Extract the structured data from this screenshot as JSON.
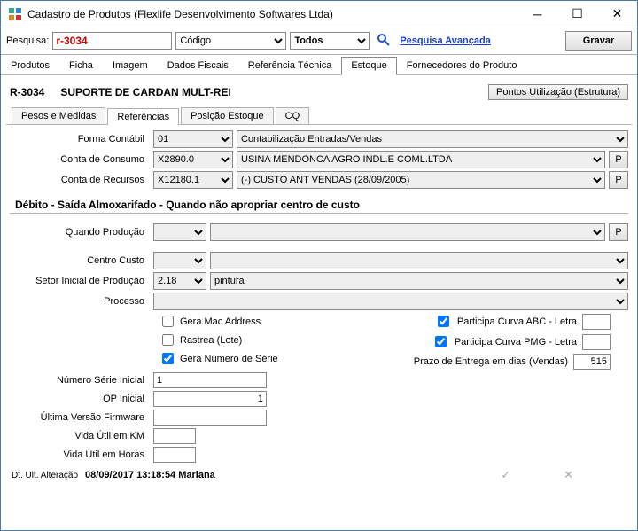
{
  "window": {
    "title": "Cadastro de Produtos (Flexlife Desenvolvimento Softwares Ltda)"
  },
  "searchbar": {
    "label": "Pesquisa:",
    "value": "r-3034",
    "combo_field": "Código",
    "combo_scope": "Todos",
    "adv": "Pesquisa Avançada",
    "gravar": "Gravar"
  },
  "maintabs": {
    "t0": "Produtos",
    "t1": "Ficha",
    "t2": "Imagem",
    "t3": "Dados Fiscais",
    "t4": "Referência Técnica",
    "t5": "Estoque",
    "t6": "Fornecedores do Produto"
  },
  "product": {
    "code": "R-3034",
    "name": "SUPORTE DE CARDAN MULT-REI",
    "pontos": "Pontos Utilização (Estrutura)"
  },
  "subtabs": {
    "s0": "Pesos e Medidas",
    "s1": "Referências",
    "s2": "Posição Estoque",
    "s3": "CQ"
  },
  "labels": {
    "forma": "Forma Contábil",
    "consumo": "Conta de Consumo",
    "recursos": "Conta de Recursos",
    "section": "Débito - Saída  Almoxarifado - Quando não apropriar centro de custo",
    "quando": "Quando Produção",
    "centro": "Centro Custo",
    "setor": "Setor Inicial de Produção",
    "processo": "Processo",
    "chk_mac": "Gera Mac Address",
    "chk_lote": "Rastrea (Lote)",
    "chk_serie": "Gera Número de Série",
    "chk_abc": "Participa Curva ABC  - Letra",
    "chk_pmg": "Participa Curva PMG - Letra",
    "prazo": "Prazo de Entrega em dias (Vendas)",
    "numserie": "Número Série Inicial",
    "opinicial": "OP Inicial",
    "firmware": "Última Versão Firmware",
    "vidakm": "Vida Útil em KM",
    "vidahoras": "Vida Útil em Horas",
    "altlabel": "Dt. Ult. Alteração",
    "p": "P"
  },
  "values": {
    "forma_code": "01",
    "forma_desc": "Contabilização Entradas/Vendas",
    "consumo_code": "X2890.0",
    "consumo_desc": "USINA MENDONCA AGRO INDL.E COML.LTDA",
    "recursos_code": "X12180.1",
    "recursos_desc": "(-) CUSTO ANT VENDAS (28/09/2005)",
    "quando_code": "",
    "quando_desc": "",
    "centro_code": "",
    "centro_desc": "",
    "setor_code": "2.18",
    "setor_desc": "pintura",
    "processo": "",
    "numserie": "1",
    "opinicial": "1",
    "firmware": "",
    "vidakm": "",
    "vidahoras": "",
    "prazo": "515",
    "altvalue": "08/09/2017 13:18:54   Mariana"
  }
}
